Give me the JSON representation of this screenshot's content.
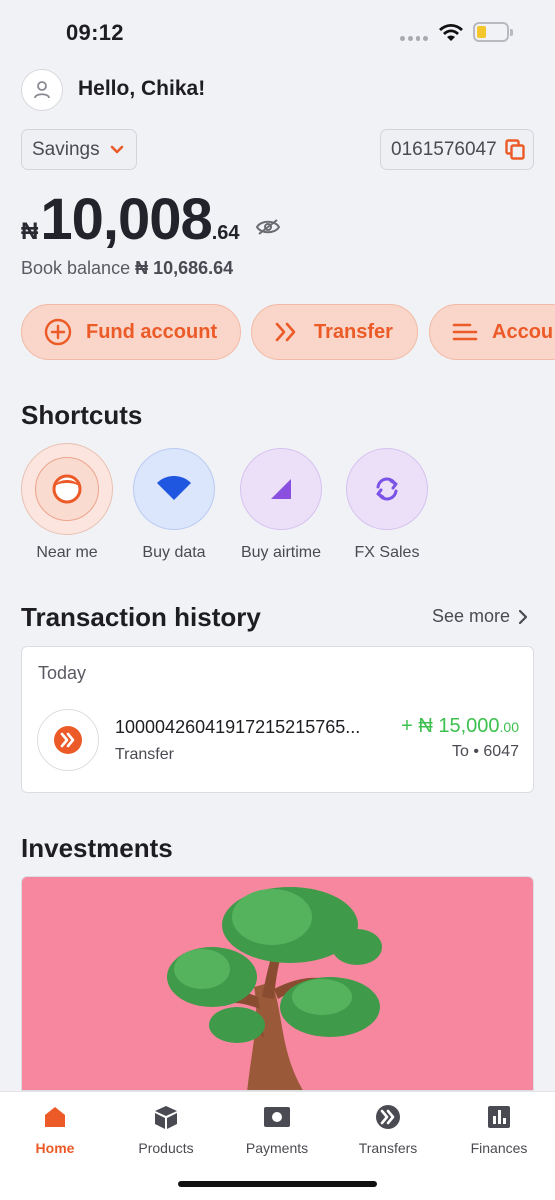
{
  "status_bar": {
    "time": "09:12"
  },
  "header": {
    "greeting": "Hello, Chika!"
  },
  "account": {
    "type": "Savings",
    "number": "0161576047"
  },
  "balance": {
    "currency": "₦",
    "main": "10,008",
    "decimal": ".64",
    "book_label": "Book balance",
    "book_value": "₦ 10,686.64"
  },
  "actions": [
    {
      "label": "Fund account",
      "icon": "plus-circle-icon"
    },
    {
      "label": "Transfer",
      "icon": "double-chevron-icon"
    },
    {
      "label": "Accou",
      "icon": "menu-lines-icon"
    }
  ],
  "shortcuts": {
    "title": "Shortcuts",
    "items": [
      {
        "label": "Near me",
        "icon": "face-icon"
      },
      {
        "label": "Buy data",
        "icon": "wifi-icon"
      },
      {
        "label": "Buy airtime",
        "icon": "signal-icon"
      },
      {
        "label": "FX Sales",
        "icon": "exchange-icon"
      }
    ]
  },
  "transactions": {
    "title": "Transaction history",
    "see_more": "See more",
    "group": "Today",
    "items": [
      {
        "name": "10000426041917215215765...",
        "type": "Transfer",
        "amount_main": "+ ₦ 15,000",
        "amount_dec": ".00",
        "to": "To • 6047"
      }
    ]
  },
  "investments": {
    "title": "Investments"
  },
  "tabbar": {
    "items": [
      {
        "label": "Home",
        "icon": "home-icon",
        "active": true
      },
      {
        "label": "Products",
        "icon": "box-icon"
      },
      {
        "label": "Payments",
        "icon": "payment-icon"
      },
      {
        "label": "Transfers",
        "icon": "transfer-icon"
      },
      {
        "label": "Finances",
        "icon": "chart-icon"
      }
    ]
  },
  "colors": {
    "accent": "#ec5a28",
    "accent_soft": "#f9d6c9",
    "positive": "#3ec04f",
    "invest_bg": "#f7879f"
  }
}
